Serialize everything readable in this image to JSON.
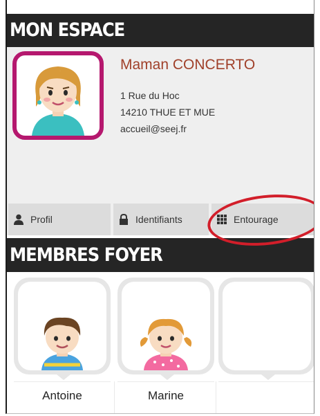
{
  "espace": {
    "title": "MON ESPACE",
    "user": {
      "name": "Maman CONCERTO",
      "address_line1": "1 Rue du Hoc",
      "address_line2": "14210 THUE ET MUE",
      "email": "accueil@seej.fr",
      "avatar": "mother-avatar"
    },
    "tabs": [
      {
        "label": "Profil",
        "icon": "person-icon"
      },
      {
        "label": "Identifiants",
        "icon": "lock-icon"
      },
      {
        "label": "Entourage",
        "icon": "grid-icon"
      }
    ],
    "highlight_color": "#d21e2a",
    "accent_color": "#b5186e"
  },
  "foyer": {
    "title": "MEMBRES FOYER",
    "members": [
      {
        "name": "Antoine",
        "avatar": "boy-avatar"
      },
      {
        "name": "Marine",
        "avatar": "girl-avatar"
      },
      {
        "name": "",
        "avatar": ""
      }
    ]
  }
}
